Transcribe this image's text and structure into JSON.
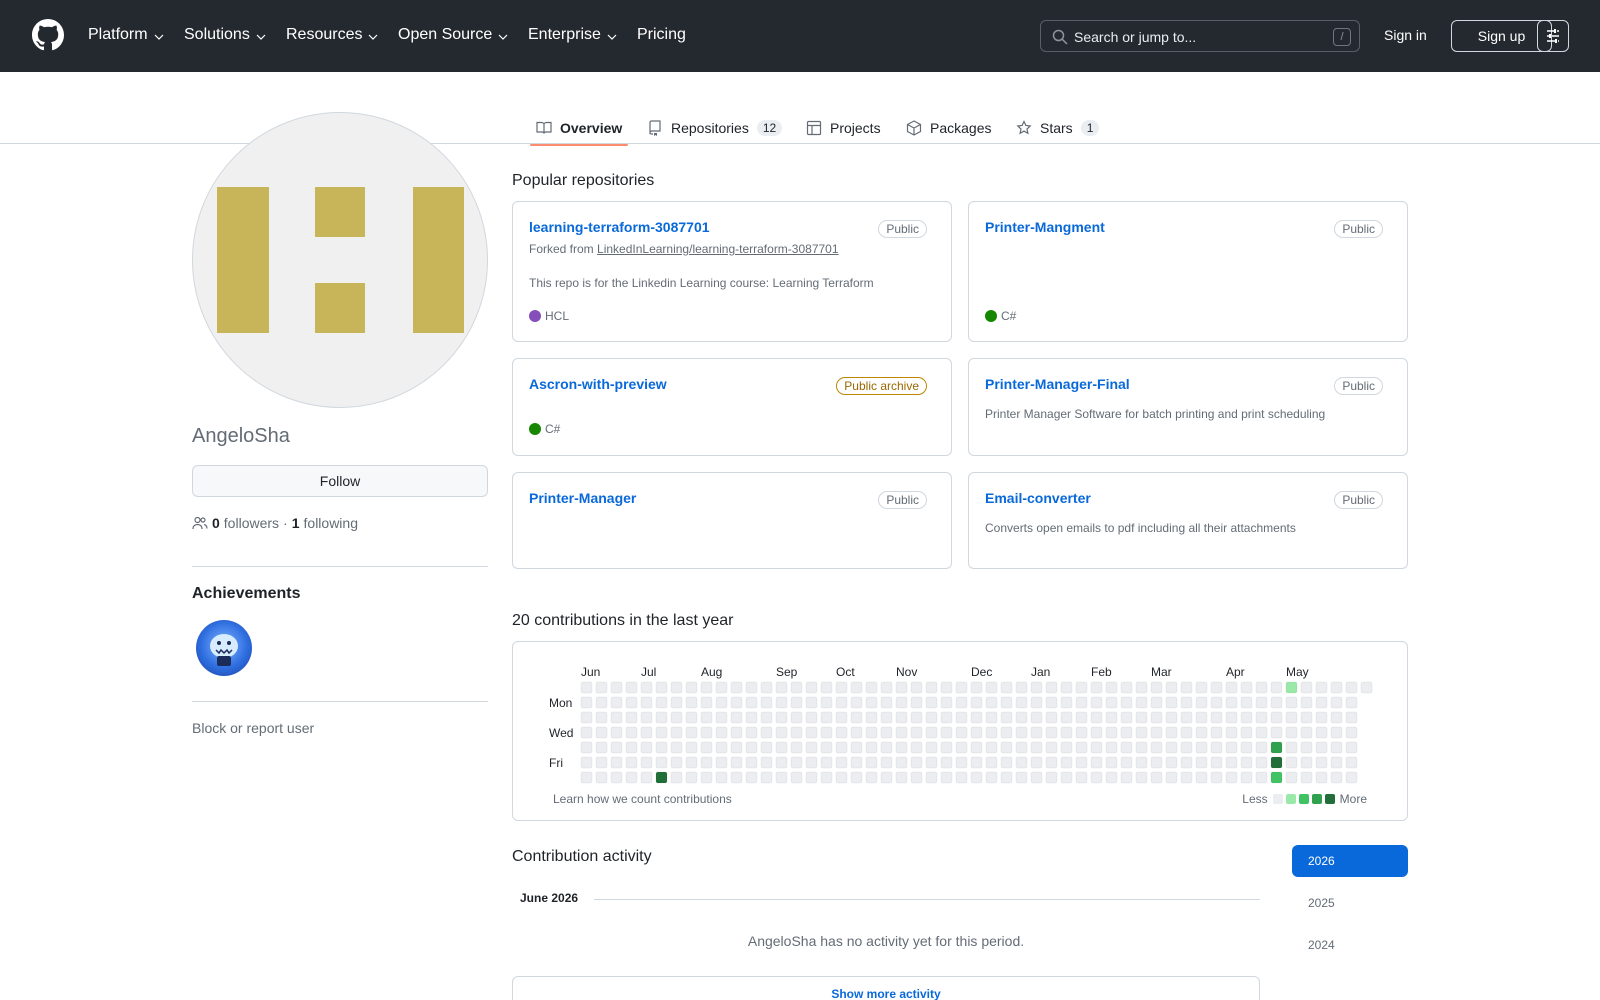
{
  "header": {
    "nav": [
      "Platform",
      "Solutions",
      "Resources",
      "Open Source",
      "Enterprise",
      "Pricing"
    ],
    "search_placeholder": "Search or jump to...",
    "search_shortcut": "/",
    "signin": "Sign in",
    "signup": "Sign up"
  },
  "tabs": [
    {
      "label": "Overview",
      "icon": "book-icon"
    },
    {
      "label": "Repositories",
      "icon": "repo-icon",
      "count": "12"
    },
    {
      "label": "Projects",
      "icon": "table-icon"
    },
    {
      "label": "Packages",
      "icon": "package-icon"
    },
    {
      "label": "Stars",
      "icon": "star-icon",
      "count": "1"
    }
  ],
  "profile": {
    "username": "AngeloSha",
    "follow_label": "Follow",
    "followers_count": "0",
    "followers_label": "followers",
    "separator": "·",
    "following_count": "1",
    "following_label": "following",
    "achievements_title": "Achievements",
    "block_report": "Block or report user"
  },
  "popular": {
    "title": "Popular repositories",
    "repos": [
      {
        "name": "learning-terraform-3087701",
        "badge": "Public",
        "fork_prefix": "Forked from",
        "fork_source": "LinkedInLearning/learning-terraform-3087701",
        "description": "This repo is for the Linkedin Learning course: Learning Terraform",
        "language": "HCL",
        "lang_color": "#844FBA"
      },
      {
        "name": "Printer-Mangment",
        "badge": "Public",
        "language": "C#",
        "lang_color": "#178600"
      },
      {
        "name": "Ascron-with-preview",
        "badge": "Public archive",
        "language": "C#",
        "lang_color": "#178600"
      },
      {
        "name": "Printer-Manager-Final",
        "badge": "Public",
        "description": "Printer Manager Software for batch printing and print scheduling"
      },
      {
        "name": "Printer-Manager",
        "badge": "Public"
      },
      {
        "name": "Email-converter",
        "badge": "Public",
        "description": "Converts open emails to pdf including all their attachments"
      }
    ]
  },
  "contributions": {
    "title": "20 contributions in the last year",
    "months": [
      "Jun",
      "Jul",
      "Aug",
      "Sep",
      "Oct",
      "Nov",
      "Dec",
      "Jan",
      "Feb",
      "Mar",
      "Apr",
      "May"
    ],
    "days": [
      "Mon",
      "Wed",
      "Fri"
    ],
    "learn_link": "Learn how we count contributions",
    "legend_less": "Less",
    "legend_more": "More",
    "level_colors": [
      "#ebedf0",
      "#9be9a8",
      "#40c463",
      "#30a14e",
      "#216e39"
    ],
    "active_cells": [
      {
        "week": 5,
        "day": 6,
        "level": 4
      },
      {
        "week": 46,
        "day": 4,
        "level": 3
      },
      {
        "week": 46,
        "day": 5,
        "level": 4
      },
      {
        "week": 46,
        "day": 6,
        "level": 2
      },
      {
        "week": 47,
        "day": 0,
        "level": 1
      }
    ]
  },
  "activity": {
    "title": "Contribution activity",
    "month": "June 2026",
    "empty_message": "AngeloSha has no activity yet for this period.",
    "show_more": "Show more activity",
    "years": [
      "2026",
      "2025",
      "2024"
    ]
  }
}
